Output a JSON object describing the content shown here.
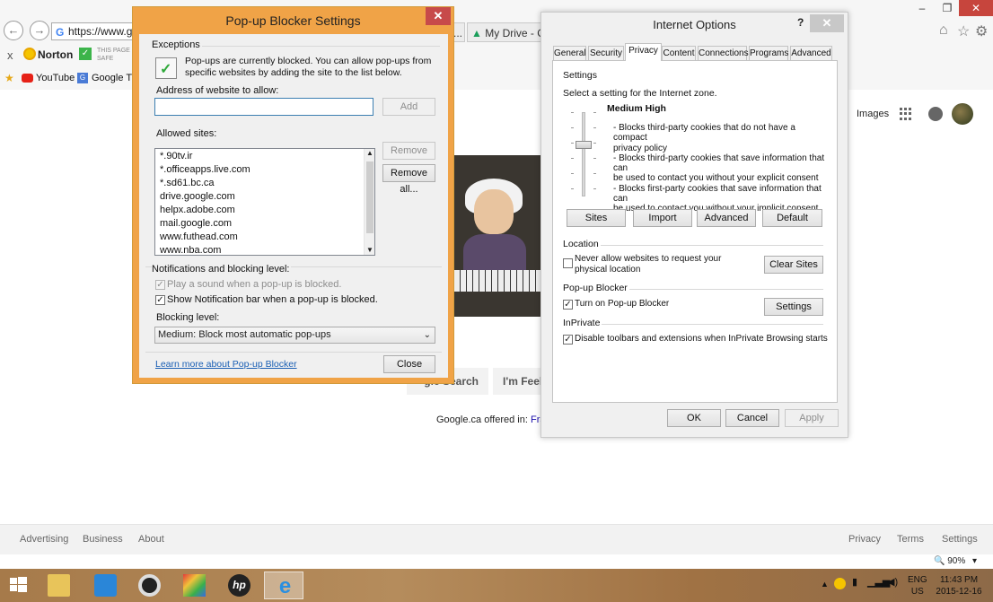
{
  "browser": {
    "address": "https://www.go",
    "tabs": [
      "...",
      "My Drive - Goo"
    ],
    "window_controls": [
      "–",
      "❐",
      "✕"
    ],
    "toolbar": {
      "close": "x",
      "norton_label": "Norton",
      "safe_line1": "THIS PAGE",
      "safe_line2": "SAFE"
    },
    "favorites": [
      {
        "label": "YouTube"
      },
      {
        "label": "Google Tra"
      }
    ]
  },
  "google": {
    "top_right": {
      "images": "Images"
    },
    "buttons": {
      "search": "gle Search",
      "lucky": "I'm Feelin"
    },
    "offered": {
      "text": "Google.ca offered in:",
      "language": "Franc"
    },
    "footer_left": [
      "Advertising",
      "Business",
      "About"
    ],
    "footer_right": [
      "Privacy",
      "Terms",
      "Settings"
    ]
  },
  "popup_dialog": {
    "title": "Pop-up Blocker Settings",
    "exceptions_label": "Exceptions",
    "info_text": "Pop-ups are currently blocked.  You can allow pop-ups from specific websites by adding the site to the list below.",
    "address_label": "Address of website to allow:",
    "address_value": "",
    "add_button": "Add",
    "allowed_label": "Allowed sites:",
    "allowed_sites": [
      "*.90tv.ir",
      "*.officeapps.live.com",
      "*.sd61.bc.ca",
      "drive.google.com",
      "helpx.adobe.com",
      "mail.google.com",
      "www.futhead.com",
      "www.nba.com"
    ],
    "remove_button": "Remove",
    "remove_all_button": "Remove all...",
    "notifications_label": "Notifications and blocking level:",
    "play_sound": "Play a sound when a pop-up is blocked.",
    "show_notification": "Show Notification bar when a pop-up is blocked.",
    "blocking_level_label": "Blocking level:",
    "blocking_level_value": "Medium: Block most automatic pop-ups",
    "learn_more": "Learn more about Pop-up Blocker",
    "close_button": "Close"
  },
  "internet_options": {
    "title": "Internet Options",
    "help": "?",
    "tabs": [
      "General",
      "Security",
      "Privacy",
      "Content",
      "Connections",
      "Programs",
      "Advanced"
    ],
    "active_tab": "Privacy",
    "settings_label": "Settings",
    "zone_text": "Select a setting for the Internet zone.",
    "level_title": "Medium High",
    "level_desc": [
      "- Blocks third-party cookies that do not have a compact",
      "privacy policy",
      "- Blocks third-party cookies that save information that can",
      "be used to contact you without your explicit consent",
      "- Blocks first-party cookies that save information that can",
      "be used to contact you without your implicit consent"
    ],
    "buttons": {
      "sites": "Sites",
      "import": "Import",
      "advanced": "Advanced",
      "default": "Default"
    },
    "location_label": "Location",
    "never_allow_line1": "Never allow websites to request your",
    "never_allow_line2": "physical location",
    "clear_sites": "Clear Sites",
    "popup_blocker_label": "Pop-up Blocker",
    "turn_on_popup": "Turn on Pop-up Blocker",
    "settings_button": "Settings",
    "inprivate_label": "InPrivate",
    "disable_toolbars": "Disable toolbars and extensions when InPrivate Browsing starts",
    "ok": "OK",
    "cancel": "Cancel",
    "apply": "Apply"
  },
  "zoom": "90%",
  "taskbar": {
    "lang_line1": "ENG",
    "lang_line2": "US",
    "time": "11:43 PM",
    "date": "2015-12-16"
  },
  "colors": {
    "popup_frame": "#f0a347",
    "close_red": "#c74a4a",
    "link_blue": "#1a5fb4"
  }
}
